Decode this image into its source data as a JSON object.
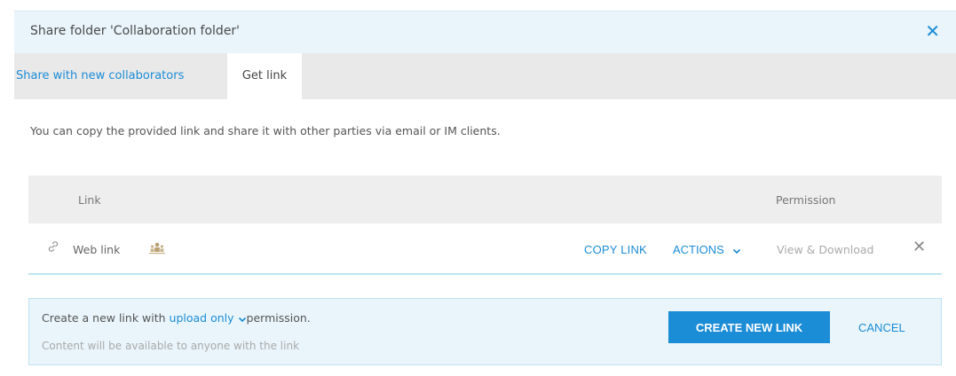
{
  "dialog": {
    "title": "Share folder 'Collaboration folder'",
    "close_icon": "close-icon"
  },
  "tabs": [
    {
      "label": "Share with new collaborators",
      "active": false
    },
    {
      "label": "Get link",
      "active": true
    }
  ],
  "description": "You can copy the provided link and share it with other parties via email or IM clients.",
  "table": {
    "headers": {
      "link": "Link",
      "permission": "Permission"
    },
    "rows": [
      {
        "icon": "link-icon",
        "label": "Web link",
        "people_icon": "people-icon",
        "copy_label": "COPY LINK",
        "actions_label": "ACTIONS",
        "permission": "View & Download",
        "remove_icon": "close-icon"
      }
    ]
  },
  "create": {
    "prefix": "Create a new link with",
    "permission_option": "upload only",
    "suffix": "permission.",
    "note": "Content will be available to anyone with the link",
    "create_label": "CREATE NEW LINK",
    "cancel_label": "CANCEL"
  },
  "colors": {
    "accent": "#1b8cd6",
    "header_bg": "#e9f5fb",
    "tabbar_bg": "#e9e9e9",
    "table_header_bg": "#eeeeee"
  }
}
